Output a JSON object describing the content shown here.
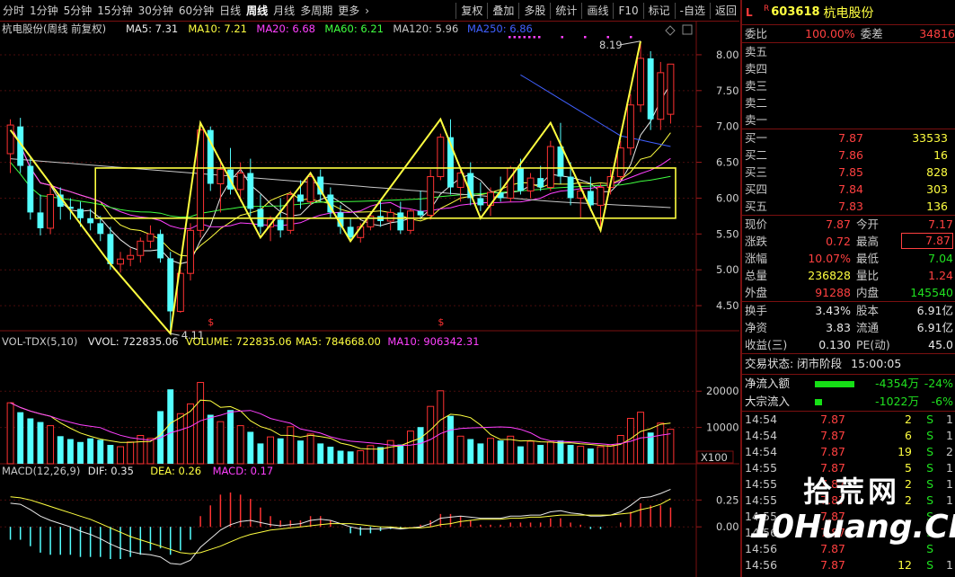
{
  "toolbar": {
    "periods": [
      "分时",
      "1分钟",
      "5分钟",
      "15分钟",
      "30分钟",
      "60分钟",
      "日线",
      "周线",
      "月线",
      "多周期",
      "更多"
    ],
    "active_period": "周线",
    "more_arrow": "›",
    "actions": [
      "复权",
      "叠加",
      "多股",
      "统计",
      "画线",
      "F10",
      "标记",
      "-自选",
      "返回"
    ]
  },
  "main_header": {
    "title": "杭电股份(周线 前复权)",
    "indicators": [
      {
        "label": "MA5: 7.31",
        "color": "#e8e8e8"
      },
      {
        "label": "MA10: 7.21",
        "color": "#ffff40"
      },
      {
        "label": "MA20: 6.68",
        "color": "#ff40ff"
      },
      {
        "label": "MA60: 6.21",
        "color": "#40ff40"
      },
      {
        "label": "MA120: 5.96",
        "color": "#c8c8c8"
      },
      {
        "label": "MA250: 6.86",
        "color": "#4060ff"
      }
    ]
  },
  "vol_header": {
    "indicators": [
      {
        "label": "VOL-TDX(5,10)",
        "color": "#c8c8c8"
      },
      {
        "label": "VVOL: 722835.06",
        "color": "#e8e8e8"
      },
      {
        "label": "VOLUME: 722835.06",
        "color": "#ffff40"
      },
      {
        "label": "MA5: 784668.00",
        "color": "#ffff40"
      },
      {
        "label": "MA10: 906342.31",
        "color": "#ff40ff"
      }
    ],
    "unit": "X100"
  },
  "macd_header": {
    "indicators": [
      {
        "label": "MACD(12,26,9)",
        "color": "#c8c8c8"
      },
      {
        "label": "DIF: 0.35",
        "color": "#e8e8e8"
      },
      {
        "label": "DEA: 0.26",
        "color": "#ffff40"
      },
      {
        "label": "MACD: 0.17",
        "color": "#ff40ff"
      }
    ]
  },
  "price_labels": {
    "high": "8.19",
    "low": "4.11"
  },
  "markers": {
    "dividend": "$"
  },
  "chart_data": [
    {
      "type": "candlestick",
      "title": "杭电股份(周线 前复权)",
      "ylim": [
        4.2,
        8.25
      ],
      "yticks": [
        4.5,
        5.0,
        5.5,
        6.0,
        6.5,
        7.0,
        7.5,
        8.0
      ],
      "ohlc": [
        [
          6.62,
          7.1,
          6.35,
          7.02
        ],
        [
          7.0,
          7.12,
          6.35,
          6.45
        ],
        [
          6.45,
          6.58,
          5.7,
          5.8
        ],
        [
          5.8,
          6.05,
          5.48,
          5.58
        ],
        [
          5.58,
          6.2,
          5.5,
          6.05
        ],
        [
          6.05,
          6.15,
          5.7,
          5.88
        ],
        [
          5.88,
          6.0,
          5.7,
          5.85
        ],
        [
          5.85,
          5.95,
          5.6,
          5.72
        ],
        [
          5.72,
          5.85,
          5.55,
          5.65
        ],
        [
          5.65,
          5.75,
          5.4,
          5.5
        ],
        [
          5.5,
          5.6,
          5.0,
          5.08
        ],
        [
          5.08,
          5.25,
          4.96,
          5.15
        ],
        [
          5.15,
          5.3,
          5.05,
          5.2
        ],
        [
          5.2,
          5.45,
          5.1,
          5.4
        ],
        [
          5.4,
          5.62,
          5.3,
          5.5
        ],
        [
          5.5,
          5.56,
          5.1,
          5.16
        ],
        [
          5.16,
          5.25,
          4.11,
          4.42
        ],
        [
          4.42,
          5.0,
          4.4,
          4.95
        ],
        [
          4.95,
          5.65,
          4.85,
          5.55
        ],
        [
          5.55,
          7.05,
          5.45,
          6.95
        ],
        [
          6.95,
          7.0,
          6.1,
          6.2
        ],
        [
          6.2,
          6.55,
          5.8,
          6.4
        ],
        [
          6.4,
          6.7,
          6.05,
          6.12
        ],
        [
          6.12,
          6.5,
          5.95,
          6.35
        ],
        [
          6.35,
          6.55,
          5.75,
          5.85
        ],
        [
          5.85,
          6.05,
          5.5,
          5.6
        ],
        [
          5.6,
          5.75,
          5.4,
          5.7
        ],
        [
          5.7,
          6.0,
          5.45,
          5.55
        ],
        [
          5.55,
          6.1,
          5.5,
          6.05
        ],
        [
          6.05,
          6.25,
          5.85,
          5.95
        ],
        [
          5.95,
          6.35,
          5.9,
          6.3
        ],
        [
          6.3,
          6.4,
          5.95,
          6.05
        ],
        [
          6.05,
          6.15,
          5.72,
          5.8
        ],
        [
          5.8,
          5.9,
          5.5,
          5.6
        ],
        [
          5.6,
          5.72,
          5.4,
          5.45
        ],
        [
          5.45,
          5.65,
          5.38,
          5.6
        ],
        [
          5.6,
          5.8,
          5.55,
          5.75
        ],
        [
          5.75,
          5.95,
          5.6,
          5.68
        ],
        [
          5.68,
          5.85,
          5.55,
          5.8
        ],
        [
          5.8,
          5.95,
          5.5,
          5.55
        ],
        [
          5.55,
          5.85,
          5.5,
          5.82
        ],
        [
          5.82,
          6.1,
          5.7,
          5.76
        ],
        [
          5.76,
          6.4,
          5.7,
          6.3
        ],
        [
          6.3,
          6.9,
          6.25,
          6.85
        ],
        [
          6.85,
          7.1,
          6.05,
          6.15
        ],
        [
          6.15,
          6.4,
          5.95,
          6.35
        ],
        [
          6.35,
          6.5,
          5.9,
          6.0
        ],
        [
          6.0,
          6.22,
          5.82,
          5.9
        ],
        [
          5.9,
          6.15,
          5.75,
          6.08
        ],
        [
          6.08,
          6.3,
          5.95,
          6.0
        ],
        [
          6.0,
          6.45,
          5.95,
          6.42
        ],
        [
          6.42,
          6.55,
          6.05,
          6.1
        ],
        [
          6.1,
          6.35,
          6.0,
          6.28
        ],
        [
          6.28,
          6.45,
          6.1,
          6.15
        ],
        [
          6.15,
          6.8,
          6.1,
          6.72
        ],
        [
          6.72,
          7.05,
          6.2,
          6.3
        ],
        [
          6.3,
          6.5,
          5.9,
          6.0
        ],
        [
          6.0,
          6.2,
          5.72,
          6.1
        ],
        [
          6.1,
          6.3,
          5.82,
          5.9
        ],
        [
          5.9,
          6.2,
          5.55,
          6.15
        ],
        [
          6.15,
          6.4,
          6.05,
          6.3
        ],
        [
          6.3,
          6.8,
          6.25,
          6.7
        ],
        [
          6.7,
          7.45,
          6.6,
          7.3
        ],
        [
          7.3,
          8.19,
          7.2,
          7.95
        ],
        [
          7.95,
          8.05,
          6.95,
          7.1
        ],
        [
          7.1,
          7.9,
          6.95,
          7.75
        ],
        [
          7.17,
          7.87,
          7.04,
          7.87
        ]
      ],
      "ma": [
        {
          "name": "MA5",
          "color": "#e8e8e8"
        },
        {
          "name": "MA10",
          "color": "#ffff40"
        },
        {
          "name": "MA20",
          "color": "#ff40ff"
        },
        {
          "name": "MA60",
          "color": "#40ff40"
        },
        {
          "name": "MA120",
          "color": "#c8c8c8"
        },
        {
          "name": "MA250",
          "color": "#4060ff"
        }
      ],
      "volume": [
        1680,
        1420,
        1250,
        1150,
        1050,
        760,
        680,
        600,
        700,
        660,
        520,
        470,
        600,
        780,
        700,
        1450,
        2050,
        1380,
        1650,
        2240,
        1350,
        1160,
        1480,
        1050,
        880,
        560,
        740,
        700,
        1020,
        640,
        820,
        560,
        470,
        360,
        340,
        360,
        500,
        460,
        640,
        530,
        900,
        1010,
        1580,
        2010,
        1320,
        760,
        680,
        560,
        700,
        640,
        760,
        480,
        620,
        520,
        600,
        640,
        520,
        480,
        420,
        470,
        520,
        780,
        1250,
        1420,
        860,
        1120,
        950
      ],
      "volume_ylim": [
        0,
        26000
      ],
      "volume_scale": 10,
      "volume_yticks": [
        10000,
        20000
      ],
      "macd": {
        "dif": [
          0.22,
          0.21,
          0.16,
          0.1,
          0.06,
          0.03,
          0.0,
          -0.04,
          -0.07,
          -0.11,
          -0.16,
          -0.2,
          -0.23,
          -0.25,
          -0.26,
          -0.28,
          -0.34,
          -0.35,
          -0.31,
          -0.19,
          -0.11,
          -0.03,
          0.02,
          0.05,
          0.06,
          0.04,
          0.02,
          0.01,
          0.02,
          0.03,
          0.06,
          0.07,
          0.06,
          0.03,
          0.0,
          -0.02,
          -0.02,
          -0.02,
          -0.01,
          -0.02,
          -0.01,
          0.0,
          0.03,
          0.08,
          0.09,
          0.1,
          0.09,
          0.08,
          0.08,
          0.08,
          0.1,
          0.1,
          0.11,
          0.11,
          0.14,
          0.15,
          0.13,
          0.12,
          0.1,
          0.1,
          0.11,
          0.14,
          0.2,
          0.27,
          0.28,
          0.31,
          0.35
        ],
        "dea": [
          0.28,
          0.27,
          0.25,
          0.22,
          0.19,
          0.16,
          0.13,
          0.1,
          0.07,
          0.03,
          -0.01,
          -0.05,
          -0.09,
          -0.12,
          -0.15,
          -0.18,
          -0.21,
          -0.24,
          -0.25,
          -0.24,
          -0.21,
          -0.18,
          -0.14,
          -0.1,
          -0.07,
          -0.05,
          -0.03,
          -0.02,
          -0.01,
          0.0,
          0.01,
          0.02,
          0.03,
          0.03,
          0.03,
          0.02,
          0.01,
          0.0,
          0.0,
          -0.01,
          -0.01,
          -0.01,
          0.0,
          0.02,
          0.03,
          0.05,
          0.06,
          0.07,
          0.07,
          0.07,
          0.08,
          0.08,
          0.09,
          0.09,
          0.1,
          0.11,
          0.11,
          0.11,
          0.11,
          0.11,
          0.11,
          0.12,
          0.13,
          0.16,
          0.18,
          0.21,
          0.26
        ],
        "ylim": [
          -0.45,
          0.42
        ],
        "yticks": [
          0.0,
          0.25
        ]
      },
      "pattern_lines": {
        "zigzag": [
          [
            0,
            6.95
          ],
          [
            10,
            5.08
          ],
          [
            16,
            4.11
          ],
          [
            19,
            7.05
          ],
          [
            25,
            5.45
          ],
          [
            30,
            6.35
          ],
          [
            34,
            5.4
          ],
          [
            43,
            7.1
          ],
          [
            47,
            5.72
          ],
          [
            54,
            7.05
          ],
          [
            59,
            5.55
          ],
          [
            63,
            8.19
          ]
        ],
        "box": {
          "i0": 9,
          "i1": 66,
          "top": 6.42,
          "bottom": 5.72
        }
      }
    }
  ],
  "quote": {
    "prefix": "L",
    "reg": "R",
    "code": "603618",
    "name": "杭电股份",
    "weibi_label": "委比",
    "weibi": "100.00%",
    "weicha_label": "委差",
    "weicha": "34816",
    "asks": [
      {
        "label": "卖五",
        "price": "",
        "vol": ""
      },
      {
        "label": "卖四",
        "price": "",
        "vol": ""
      },
      {
        "label": "卖三",
        "price": "",
        "vol": ""
      },
      {
        "label": "卖二",
        "price": "",
        "vol": ""
      },
      {
        "label": "卖一",
        "price": "",
        "vol": ""
      }
    ],
    "bids": [
      {
        "label": "买一",
        "price": "7.87",
        "vol": "33533"
      },
      {
        "label": "买二",
        "price": "7.86",
        "vol": "16"
      },
      {
        "label": "买三",
        "price": "7.85",
        "vol": "828"
      },
      {
        "label": "买四",
        "price": "7.84",
        "vol": "303"
      },
      {
        "label": "买五",
        "price": "7.83",
        "vol": "136"
      }
    ],
    "stats": [
      {
        "l1": "现价",
        "v1": "7.87",
        "c1": "red",
        "l2": "今开",
        "v2": "7.17",
        "c2": "red"
      },
      {
        "l1": "涨跌",
        "v1": "0.72",
        "c1": "red",
        "l2": "最高",
        "v2": "7.87",
        "c2": "red"
      },
      {
        "l1": "涨幅",
        "v1": "10.07%",
        "c1": "red",
        "l2": "最低",
        "v2": "7.04",
        "c2": "grn"
      },
      {
        "l1": "总量",
        "v1": "236828",
        "c1": "yel",
        "l2": "量比",
        "v2": "1.24",
        "c2": "red"
      },
      {
        "l1": "外盘",
        "v1": "91288",
        "c1": "red",
        "l2": "内盘",
        "v2": "145540",
        "c2": "grn"
      }
    ],
    "fund": [
      {
        "l1": "换手",
        "v1": "3.43%",
        "l2": "股本",
        "v2": "6.91亿"
      },
      {
        "l1": "净资",
        "v1": "3.83",
        "l2": "流通",
        "v2": "6.91亿"
      },
      {
        "l1": "收益(三)",
        "v1": "0.130",
        "l2": "PE(动)",
        "v2": "45.0"
      }
    ],
    "trade_status": "交易状态: 闭市阶段",
    "trade_time": "15:00:05",
    "flows": [
      {
        "label": "净流入额",
        "amount": "-4354万",
        "pct": "-24%",
        "bar": 0.55
      },
      {
        "label": "大宗流入",
        "amount": "-1022万",
        "pct": "-6%",
        "bar": 0.1
      }
    ],
    "ticks": [
      {
        "t": "14:54",
        "p": "7.87",
        "v": "2",
        "d": "S",
        "n": "1"
      },
      {
        "t": "14:54",
        "p": "7.87",
        "v": "6",
        "d": "S",
        "n": "1"
      },
      {
        "t": "14:54",
        "p": "7.87",
        "v": "19",
        "d": "S",
        "n": "2"
      },
      {
        "t": "14:55",
        "p": "7.87",
        "v": "5",
        "d": "S",
        "n": "1"
      },
      {
        "t": "14:55",
        "p": "7.87",
        "v": "2",
        "d": "S",
        "n": "1"
      },
      {
        "t": "14:55",
        "p": "7.87",
        "v": "2",
        "d": "S",
        "n": "1"
      },
      {
        "t": "14:55",
        "p": "7.87",
        "v": "",
        "d": "S",
        "n": ""
      },
      {
        "t": "14:56",
        "p": "7.87",
        "v": "",
        "d": "S",
        "n": ""
      },
      {
        "t": "14:56",
        "p": "7.87",
        "v": "",
        "d": "S",
        "n": ""
      },
      {
        "t": "14:56",
        "p": "7.87",
        "v": "12",
        "d": "S",
        "n": "1"
      }
    ]
  },
  "watermark": {
    "cn": "拾荒网",
    "en": "10Huang.CN"
  }
}
